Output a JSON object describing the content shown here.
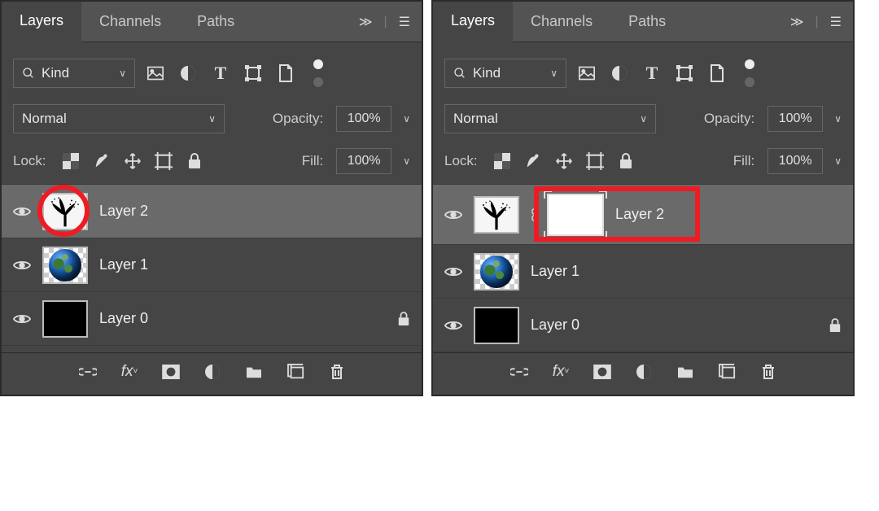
{
  "tabs": {
    "layers": "Layers",
    "channels": "Channels",
    "paths": "Paths"
  },
  "filter": {
    "kind": "Kind"
  },
  "blend": {
    "mode": "Normal",
    "opacity_label": "Opacity:",
    "opacity_value": "100%"
  },
  "lock": {
    "label": "Lock:",
    "fill_label": "Fill:",
    "fill_value": "100%"
  },
  "layers_left": [
    {
      "name": "Layer 2",
      "thumb": "tree",
      "selected": true
    },
    {
      "name": "Layer 1",
      "thumb": "earth"
    },
    {
      "name": "Layer 0",
      "thumb": "black",
      "locked": true
    }
  ],
  "layers_right": [
    {
      "name": "Layer 2",
      "thumb": "tree",
      "mask": true,
      "selected": true
    },
    {
      "name": "Layer 1",
      "thumb": "earth"
    },
    {
      "name": "Layer 0",
      "thumb": "black",
      "locked": true
    }
  ],
  "annotations": {
    "left_circle": "thumb-selected",
    "right_rect": "mask-thumb"
  }
}
